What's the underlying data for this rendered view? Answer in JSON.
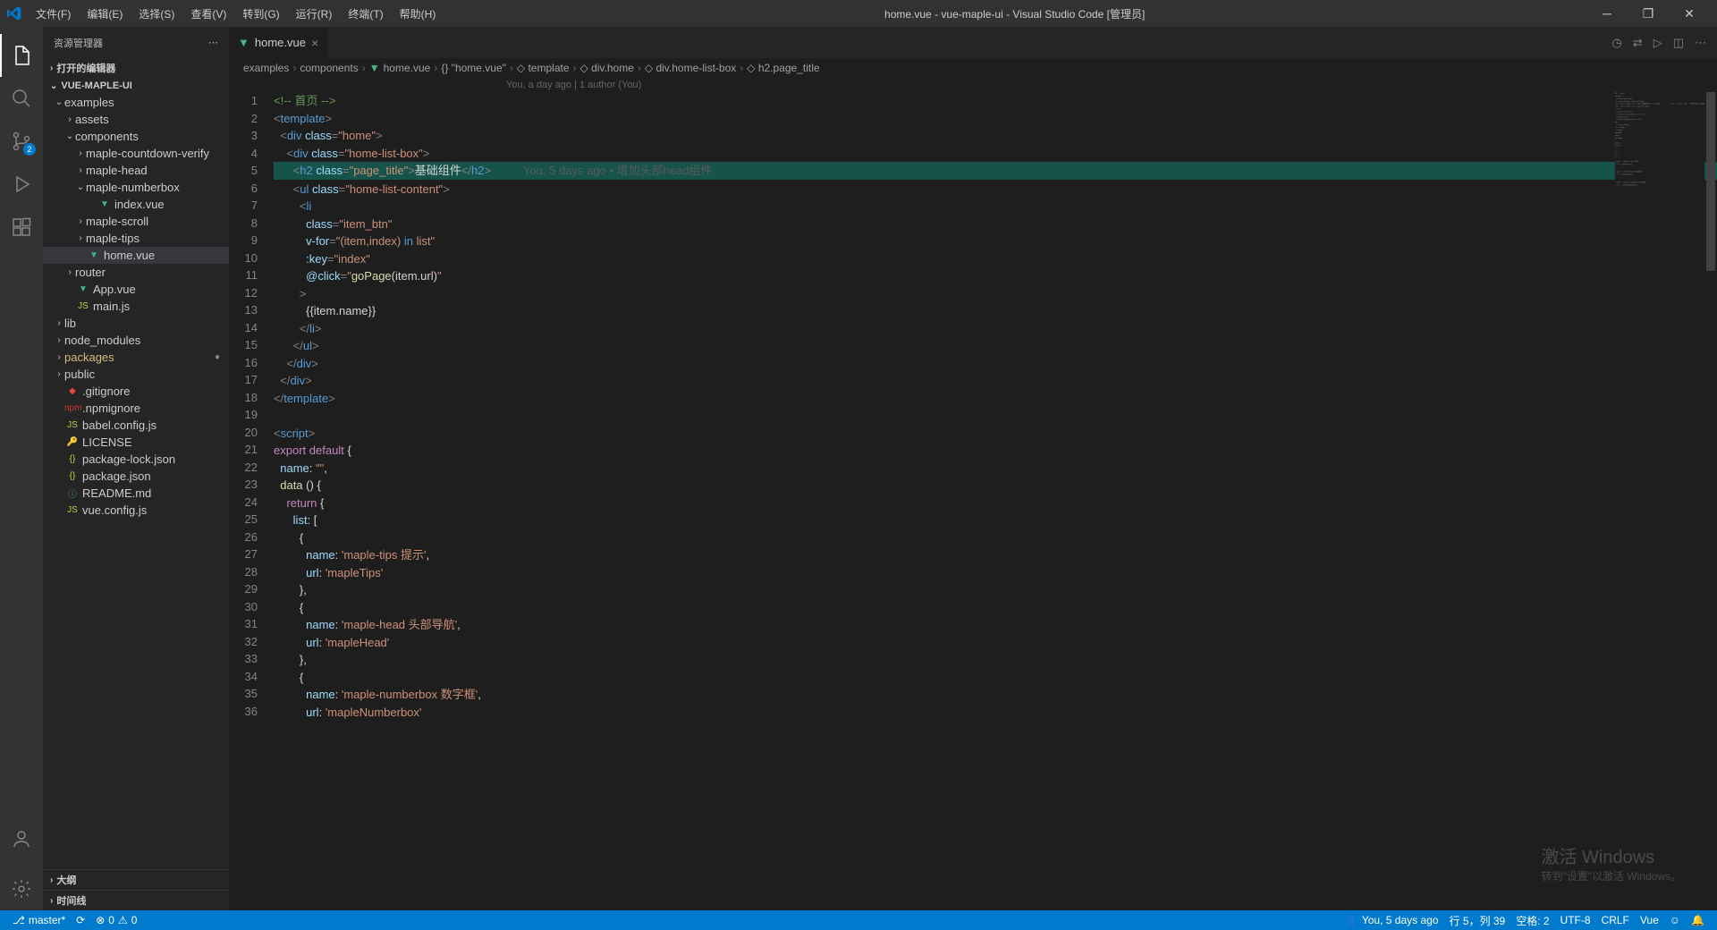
{
  "titlebar": {
    "menus": [
      "文件(F)",
      "编辑(E)",
      "选择(S)",
      "查看(V)",
      "转到(G)",
      "运行(R)",
      "终端(T)",
      "帮助(H)"
    ],
    "title": "home.vue - vue-maple-ui - Visual Studio Code [管理员]"
  },
  "activitybar": {
    "scm_badge": "2"
  },
  "sidebar": {
    "title": "资源管理器",
    "open_editors": "打开的编辑器",
    "project": "VUE-MAPLE-UI",
    "tree": [
      {
        "indent": 1,
        "type": "folder",
        "open": true,
        "label": "examples"
      },
      {
        "indent": 2,
        "type": "folder",
        "open": false,
        "label": "assets"
      },
      {
        "indent": 2,
        "type": "folder",
        "open": true,
        "label": "components"
      },
      {
        "indent": 3,
        "type": "folder",
        "open": false,
        "label": "maple-countdown-verify"
      },
      {
        "indent": 3,
        "type": "folder",
        "open": false,
        "label": "maple-head"
      },
      {
        "indent": 3,
        "type": "folder",
        "open": true,
        "label": "maple-numberbox"
      },
      {
        "indent": 4,
        "type": "file",
        "icon": "vue",
        "label": "index.vue"
      },
      {
        "indent": 3,
        "type": "folder",
        "open": false,
        "label": "maple-scroll"
      },
      {
        "indent": 3,
        "type": "folder",
        "open": false,
        "label": "maple-tips"
      },
      {
        "indent": 3,
        "type": "file",
        "icon": "vue",
        "label": "home.vue",
        "active": true
      },
      {
        "indent": 2,
        "type": "folder",
        "open": false,
        "label": "router"
      },
      {
        "indent": 2,
        "type": "file",
        "icon": "vue",
        "label": "App.vue"
      },
      {
        "indent": 2,
        "type": "file",
        "icon": "js",
        "label": "main.js"
      },
      {
        "indent": 1,
        "type": "folder",
        "open": false,
        "label": "lib"
      },
      {
        "indent": 1,
        "type": "folder",
        "open": false,
        "label": "node_modules"
      },
      {
        "indent": 1,
        "type": "folder",
        "open": false,
        "label": "packages",
        "modified": true
      },
      {
        "indent": 1,
        "type": "folder",
        "open": false,
        "label": "public"
      },
      {
        "indent": 1,
        "type": "file",
        "icon": "git",
        "label": ".gitignore"
      },
      {
        "indent": 1,
        "type": "file",
        "icon": "npm",
        "label": ".npmignore"
      },
      {
        "indent": 1,
        "type": "file",
        "icon": "js",
        "label": "babel.config.js"
      },
      {
        "indent": 1,
        "type": "file",
        "icon": "lic",
        "label": "LICENSE"
      },
      {
        "indent": 1,
        "type": "file",
        "icon": "json",
        "label": "package-lock.json"
      },
      {
        "indent": 1,
        "type": "file",
        "icon": "json",
        "label": "package.json"
      },
      {
        "indent": 1,
        "type": "file",
        "icon": "md",
        "label": "README.md"
      },
      {
        "indent": 1,
        "type": "file",
        "icon": "js",
        "label": "vue.config.js"
      }
    ],
    "outline": "大纲",
    "timeline": "时间线"
  },
  "tabs": {
    "tab1": "home.vue"
  },
  "breadcrumb": [
    "examples",
    "components",
    "home.vue",
    "\"home.vue\"",
    "template",
    "div.home",
    "div.home-list-box",
    "h2.page_title"
  ],
  "gitlens_top": "You, a day ago | 1 author (You)",
  "code": {
    "lines": 36,
    "inline_blame": "You, 5 days ago • 增加头部head组件"
  },
  "statusbar": {
    "branch": "master*",
    "sync": "",
    "errors": "0",
    "warnings": "0",
    "blame": "You, 5 days ago",
    "line_col": "行 5，列 39",
    "spaces": "空格: 2",
    "encoding": "UTF-8",
    "eol": "CRLF",
    "lang": "Vue"
  },
  "watermark": {
    "title": "激活 Windows",
    "sub": "转到\"设置\"以激活 Windows。"
  }
}
